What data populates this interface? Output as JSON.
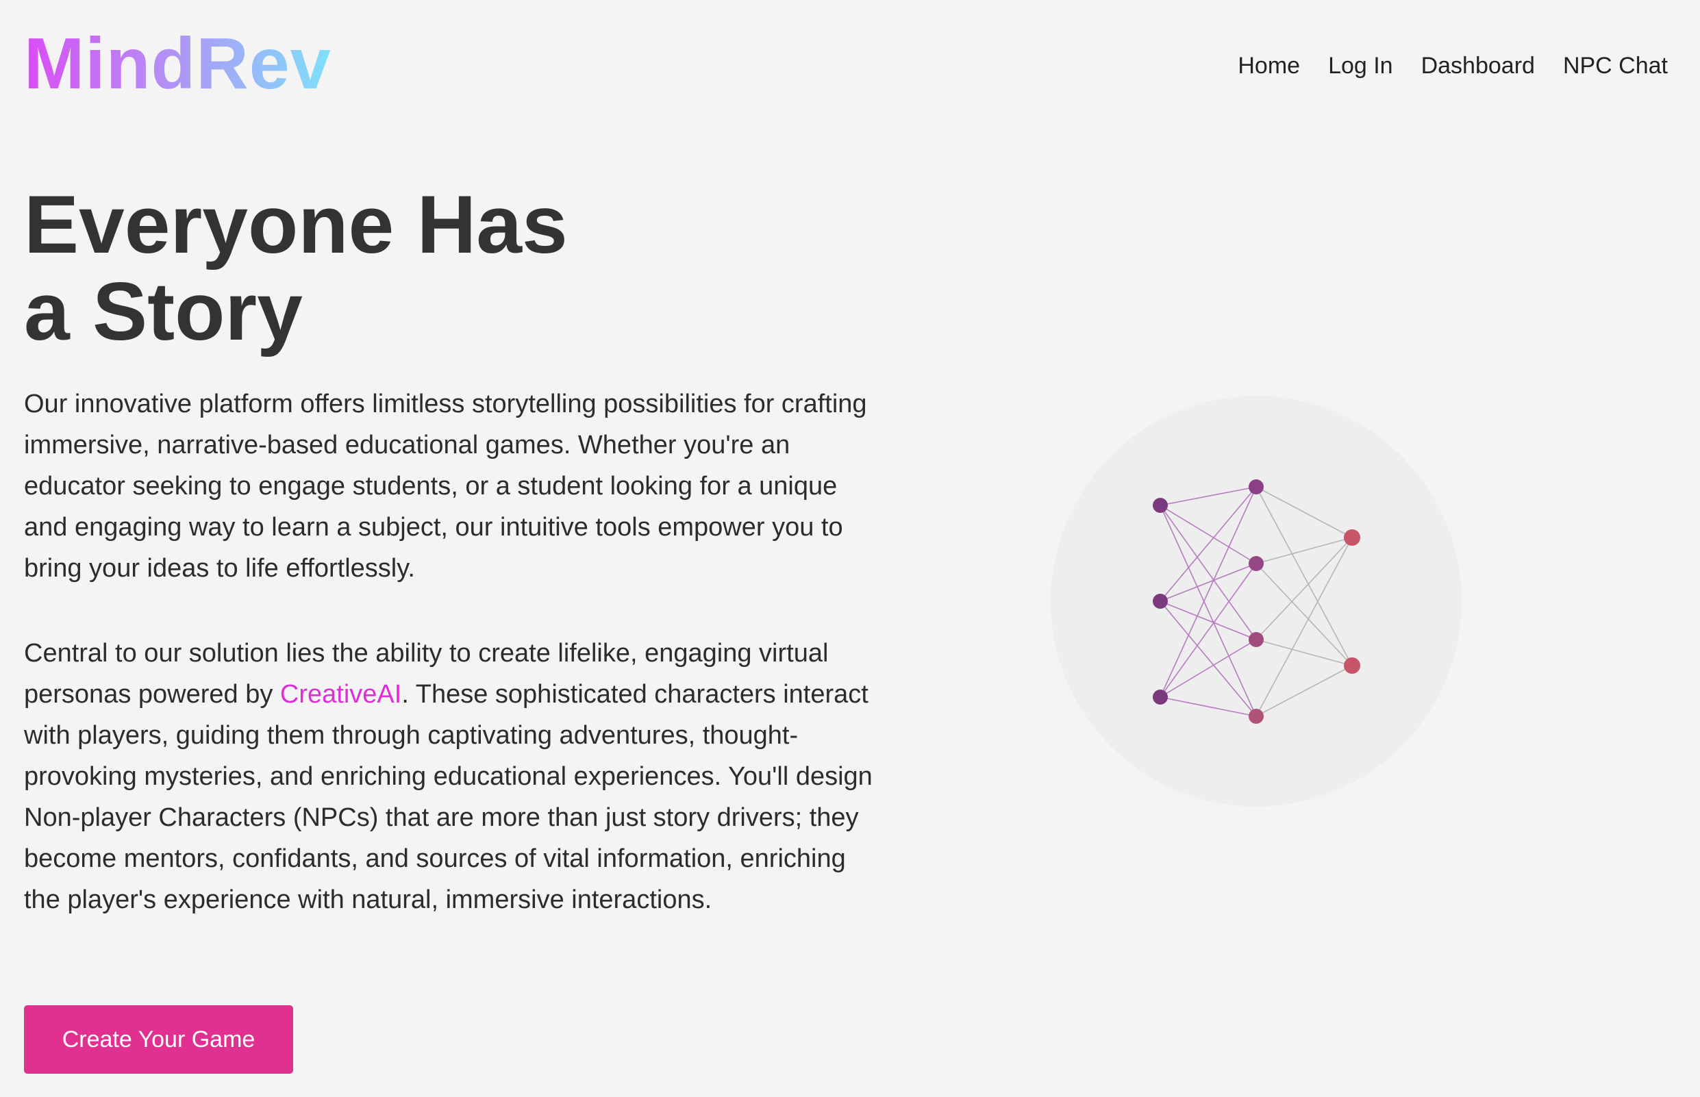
{
  "header": {
    "logo": "MindRev",
    "nav": [
      {
        "label": "Home"
      },
      {
        "label": "Log In"
      },
      {
        "label": "Dashboard"
      },
      {
        "label": "NPC Chat"
      }
    ]
  },
  "hero": {
    "title_line1": "Everyone Has",
    "title_line2": "a Story",
    "paragraph1": "Our innovative platform offers limitless storytelling possibilities for crafting immersive, narrative-based educational games. Whether you're an educator seeking to engage students, or a student looking for a unique and engaging way to learn a subject, our intuitive tools empower you to bring your ideas to life effortlessly.",
    "paragraph2_before": "Central to our solution lies the ability to create lifelike, engaging virtual personas powered by ",
    "paragraph2_highlight": "CreativeAI",
    "paragraph2_after": ". These sophisticated characters interact with players, guiding them through captivating adventures, thought-provoking mysteries, and enriching educational experiences. You'll design Non-player Characters (NPCs) that are more than just story drivers; they become mentors, confidants, and sources of vital information, enriching the player's experience with natural, immersive interactions.",
    "cta_label": "Create Your Game"
  },
  "illustration": {
    "icon": "neural-network-icon",
    "layers": [
      3,
      4,
      2
    ],
    "colors": {
      "circle_bg": "#eeeeee",
      "input_nodes": "#7a3a80",
      "hidden_nodes": [
        "#8a3f86",
        "#954685",
        "#a04a7e",
        "#b05278"
      ],
      "output_nodes": "#c85468",
      "input_edges": "#b77bc0",
      "other_edges": "#b5b5b5"
    }
  },
  "colors": {
    "background": "#f4f4f4",
    "accent": "#e03090",
    "highlight_text": "#dd2fd6",
    "logo_gradient": [
      "#d94df5",
      "#b48ef4",
      "#7ee0fb"
    ]
  }
}
